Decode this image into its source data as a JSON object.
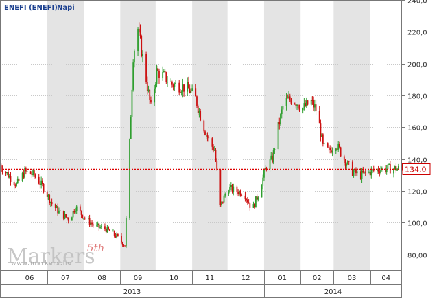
{
  "colors": {
    "up": "#2e9e2e",
    "down": "#cc1111",
    "shade": "#e4e4e4",
    "grid": "#c8c8c8",
    "current_line": "#dd0000",
    "title": "#1a3f8f"
  },
  "chart_data": {
    "type": "candlestick",
    "title": "ENEFI (ENEFI)",
    "subtitle": "Napi",
    "y_axis": {
      "min": 70,
      "max": 240,
      "ticks": [
        "80,00",
        "100,0",
        "120,0",
        "140,0",
        "160,0",
        "180,0",
        "200,0",
        "220,0",
        "240,0"
      ],
      "tick_values": [
        80,
        100,
        120,
        140,
        160,
        180,
        200,
        220,
        240
      ],
      "position": "right"
    },
    "x_axis": {
      "start": "2013-05-22",
      "end": "2014-04-28",
      "months": [
        {
          "label": "06",
          "start": "2013-06-01",
          "end": "2013-07-01"
        },
        {
          "label": "07",
          "start": "2013-07-01",
          "end": "2013-08-01"
        },
        {
          "label": "08",
          "start": "2013-08-01",
          "end": "2013-09-01"
        },
        {
          "label": "09",
          "start": "2013-09-01",
          "end": "2013-10-01"
        },
        {
          "label": "10",
          "start": "2013-10-01",
          "end": "2013-11-01"
        },
        {
          "label": "11",
          "start": "2013-11-01",
          "end": "2013-12-01"
        },
        {
          "label": "12",
          "start": "2013-12-01",
          "end": "2014-01-01"
        },
        {
          "label": "01",
          "start": "2014-01-01",
          "end": "2014-02-01"
        },
        {
          "label": "02",
          "start": "2014-02-01",
          "end": "2014-03-01"
        },
        {
          "label": "03",
          "start": "2014-03-01",
          "end": "2014-04-01"
        },
        {
          "label": "04",
          "start": "2014-04-01",
          "end": "2014-04-28"
        }
      ],
      "years": [
        {
          "label": "2013",
          "start": "2013-05-22",
          "end": "2014-01-01"
        },
        {
          "label": "2014",
          "start": "2014-01-01",
          "end": "2014-04-28"
        }
      ]
    },
    "current_value": 134.0,
    "current_label": "134,0",
    "price_path": [
      [
        "2013-05-22",
        136
      ],
      [
        "2013-06-05",
        124
      ],
      [
        "2013-06-12",
        132
      ],
      [
        "2013-06-20",
        130
      ],
      [
        "2013-06-28",
        122
      ],
      [
        "2013-07-05",
        112
      ],
      [
        "2013-07-12",
        106
      ],
      [
        "2013-07-20",
        102
      ],
      [
        "2013-07-25",
        110
      ],
      [
        "2013-08-01",
        104
      ],
      [
        "2013-08-10",
        98
      ],
      [
        "2013-08-20",
        96
      ],
      [
        "2013-08-28",
        92
      ],
      [
        "2013-09-05",
        86
      ],
      [
        "2013-09-09",
        150
      ],
      [
        "2013-09-12",
        205
      ],
      [
        "2013-09-16",
        222
      ],
      [
        "2013-09-22",
        195
      ],
      [
        "2013-09-27",
        172
      ],
      [
        "2013-10-02",
        195
      ],
      [
        "2013-10-08",
        192
      ],
      [
        "2013-10-15",
        187
      ],
      [
        "2013-10-22",
        186
      ],
      [
        "2013-10-29",
        184
      ],
      [
        "2013-11-04",
        178
      ],
      [
        "2013-11-10",
        162
      ],
      [
        "2013-11-16",
        150
      ],
      [
        "2013-11-20",
        146
      ],
      [
        "2013-11-25",
        110
      ],
      [
        "2013-12-01",
        122
      ],
      [
        "2013-12-08",
        120
      ],
      [
        "2013-12-15",
        119
      ],
      [
        "2013-12-22",
        108
      ],
      [
        "2013-12-28",
        120
      ],
      [
        "2014-01-03",
        136
      ],
      [
        "2014-01-08",
        140
      ],
      [
        "2014-01-13",
        160
      ],
      [
        "2014-01-18",
        176
      ],
      [
        "2014-01-25",
        178
      ],
      [
        "2014-02-03",
        172
      ],
      [
        "2014-02-10",
        176
      ],
      [
        "2014-02-15",
        170
      ],
      [
        "2014-02-20",
        148
      ],
      [
        "2014-02-25",
        145
      ],
      [
        "2014-03-03",
        150
      ],
      [
        "2014-03-10",
        140
      ],
      [
        "2014-03-17",
        132
      ],
      [
        "2014-03-24",
        130
      ],
      [
        "2014-04-01",
        132
      ],
      [
        "2014-04-10",
        134
      ],
      [
        "2014-04-20",
        134
      ],
      [
        "2014-04-28",
        134
      ]
    ]
  },
  "watermark": {
    "brand": "Markers",
    "edition": "5th",
    "url": "www.markers.hu"
  }
}
